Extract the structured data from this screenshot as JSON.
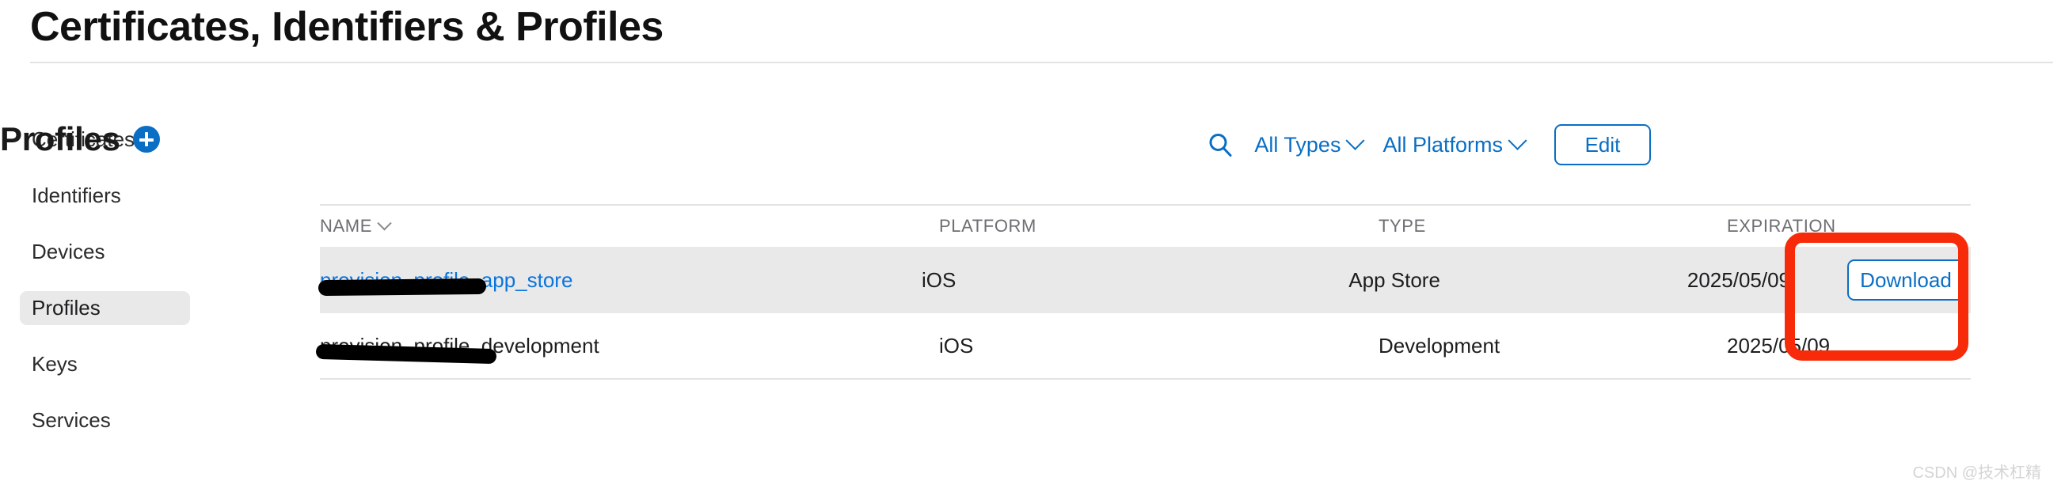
{
  "page": {
    "title": "Certificates, Identifiers & Profiles"
  },
  "sidebar": {
    "items": [
      {
        "label": "Certificates",
        "selected": false
      },
      {
        "label": "Identifiers",
        "selected": false
      },
      {
        "label": "Devices",
        "selected": false
      },
      {
        "label": "Profiles",
        "selected": true
      },
      {
        "label": "Keys",
        "selected": false
      },
      {
        "label": "Services",
        "selected": false
      }
    ]
  },
  "main": {
    "heading": "Profiles",
    "add_icon": "plus-circle-icon",
    "toolbar": {
      "search_icon": "search-icon",
      "type_filter": "All Types",
      "platform_filter": "All Platforms",
      "edit_label": "Edit"
    },
    "table": {
      "columns": {
        "name": "NAME",
        "platform": "PLATFORM",
        "type": "TYPE",
        "expiration": "EXPIRATION"
      },
      "sort_icon": "chevron-down-icon",
      "rows": [
        {
          "name": "provision_profile_app_store",
          "platform": "iOS",
          "type": "App Store",
          "expiration": "2025/05/09",
          "action": "Download"
        },
        {
          "name": "provision_profile_development",
          "platform": "iOS",
          "type": "Development",
          "expiration": "2025/05/09",
          "action": ""
        }
      ]
    }
  },
  "annotation": {
    "highlight_color": "#f72b0a",
    "target": "download-button"
  },
  "watermark": {
    "text": "CSDN @技术杠精"
  },
  "colors": {
    "accent_blue": "#0a6ec4",
    "link_blue": "#0a74dd",
    "row_highlight": "#e9e9e9",
    "divider": "#e3e3e3"
  }
}
